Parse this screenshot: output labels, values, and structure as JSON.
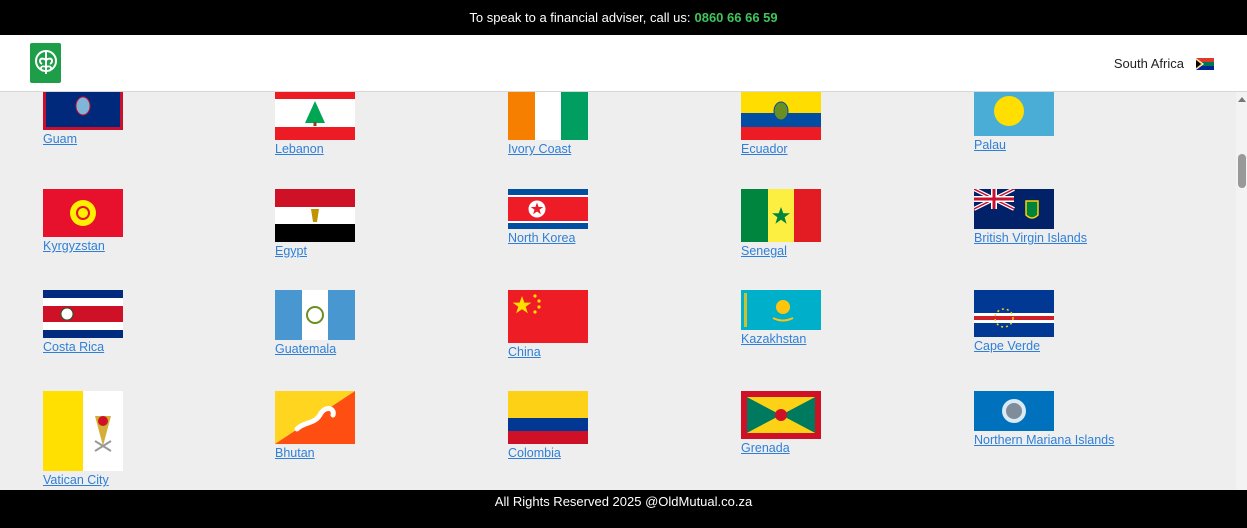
{
  "topbar": {
    "text": "To speak to a financial adviser, call us:",
    "phone": "0860 66 66 59"
  },
  "header": {
    "country": "South Africa"
  },
  "flags": {
    "guam": "Guam",
    "lebanon": "Lebanon",
    "ivory_coast": "Ivory Coast",
    "ecuador": "Ecuador",
    "palau": "Palau",
    "kyrgyzstan": "Kyrgyzstan",
    "egypt": "Egypt",
    "north_korea": "North Korea",
    "senegal": "Senegal",
    "bvi": "British Virgin Islands",
    "costa_rica": "Costa Rica",
    "guatemala": "Guatemala",
    "china": "China",
    "kazakhstan": "Kazakhstan",
    "cape_verde": "Cape Verde",
    "vatican": "Vatican City",
    "bhutan": "Bhutan",
    "colombia": "Colombia",
    "grenada": "Grenada",
    "nmi": "Northern Mariana Islands"
  },
  "footer": {
    "text": "All Rights Reserved 2025 @OldMutual.co.za"
  },
  "colors": {
    "accent": "#3ec65a",
    "link": "#2f7fd8",
    "brand": "#1f9e4a"
  }
}
